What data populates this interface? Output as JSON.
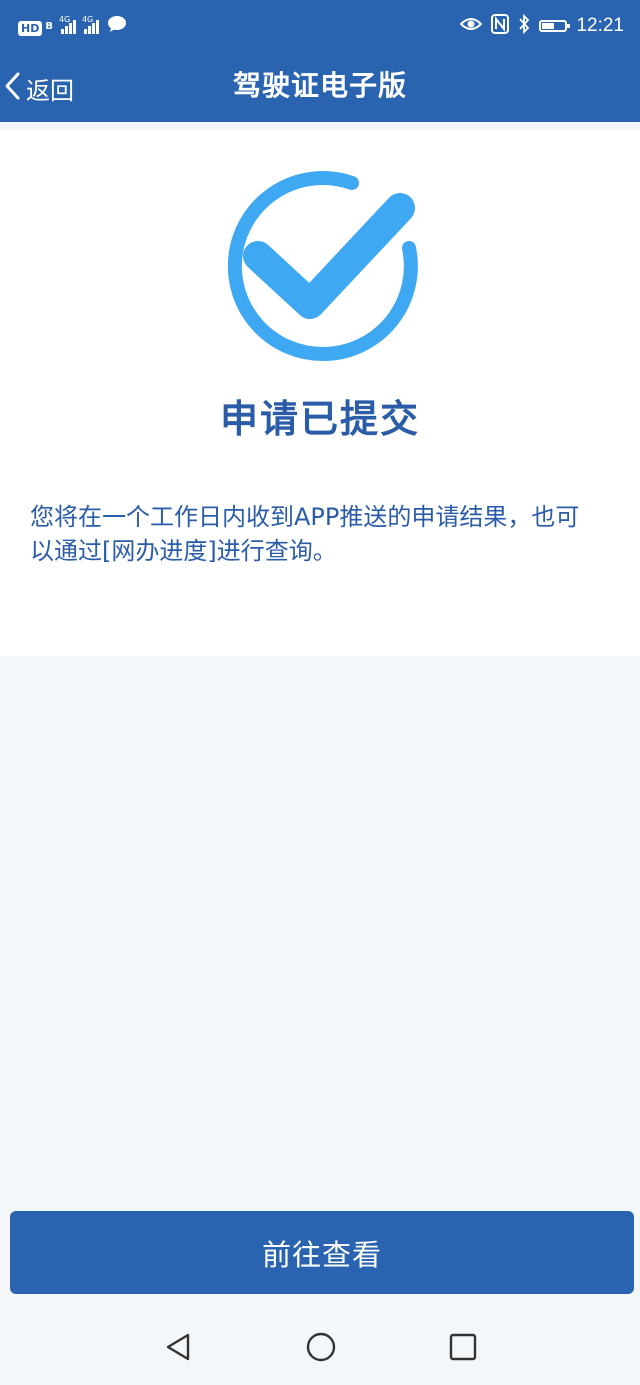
{
  "status_bar": {
    "hd_badge": "HD",
    "hd_sub": "B",
    "sim1_tag": "4G",
    "sim2_tag": "4G",
    "time": "12:21",
    "battery_level": 0.55,
    "icons": [
      "hd-icon",
      "signal-icon",
      "signal-icon",
      "message-icon",
      "eye-icon",
      "nfc-icon",
      "bluetooth-icon",
      "battery-icon"
    ]
  },
  "header": {
    "back_label": "返回",
    "title": "驾驶证电子版"
  },
  "result": {
    "icon": "check-circle-icon",
    "title": "申请已提交",
    "description": "您将在一个工作日内收到APP推送的申请结果，也可以通过[网办进度]进行查询。"
  },
  "actions": {
    "primary_label": "前往查看"
  },
  "system_nav": {
    "icons": [
      "back-triangle-icon",
      "home-circle-icon",
      "recents-square-icon"
    ]
  },
  "colors": {
    "brand_blue": "#2a64b0",
    "text_blue": "#2b5ca8",
    "check_blue": "#3ea8f2",
    "page_bg": "#f3f7fa"
  }
}
